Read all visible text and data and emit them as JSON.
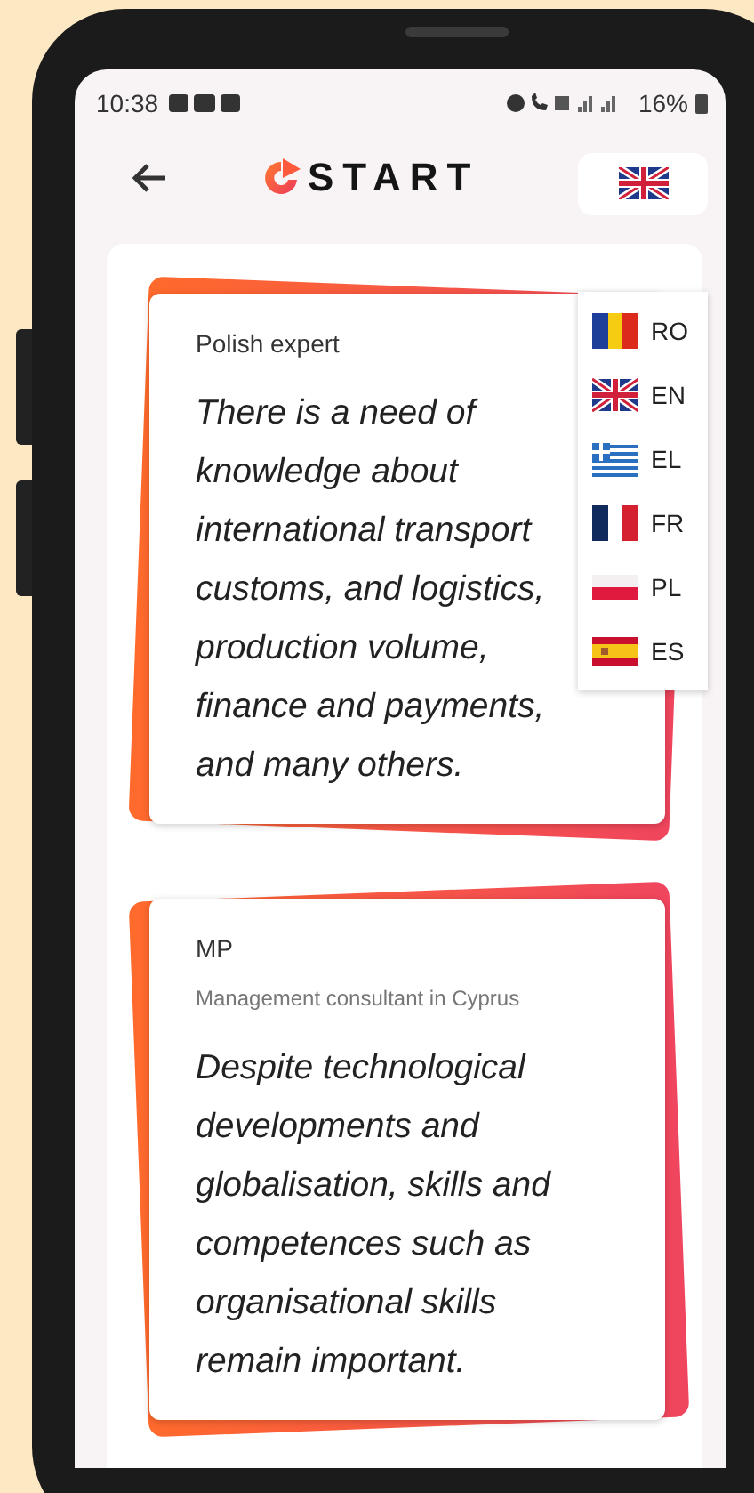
{
  "status_bar": {
    "time": "10:38",
    "battery": "16%"
  },
  "header": {
    "logo": "START"
  },
  "language_menu": [
    {
      "kind": "ro",
      "label": "RO"
    },
    {
      "kind": "gb",
      "label": "EN"
    },
    {
      "kind": "gr",
      "label": "EL"
    },
    {
      "kind": "fr",
      "label": "FR"
    },
    {
      "kind": "pl",
      "label": "PL"
    },
    {
      "kind": "es",
      "label": "ES"
    }
  ],
  "cards": [
    {
      "name": "Polish expert",
      "quote": "There is a need of knowledge about international transport customs, and logistics, production volume, finance and payments, and many others."
    },
    {
      "name": "MP",
      "role": "Management consultant in Cyprus",
      "quote": "Despite technological developments and globalisation, skills and competences such as organisational skills remain important."
    }
  ]
}
